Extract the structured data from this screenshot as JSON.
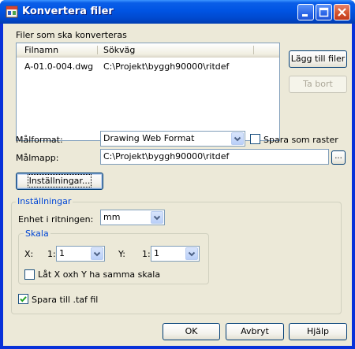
{
  "window": {
    "title": "Konvertera filer"
  },
  "files_section": {
    "label": "Filer som ska konverteras",
    "columns": [
      "Filnamn",
      "Sökväg"
    ],
    "rows": [
      {
        "filename": "A-01.0-004.dwg",
        "path": "C:\\Projekt\\byggh90000\\ritdef"
      }
    ],
    "add_button": "Lägg till filer",
    "remove_button": "Ta bort"
  },
  "target_format": {
    "label": "Målformat:",
    "value": "Drawing Web Format",
    "raster_label": "Spara som raster",
    "raster_checked": false
  },
  "target_folder": {
    "label": "Målmapp:",
    "value": "C:\\Projekt\\byggh90000\\ritdef",
    "browse": "..."
  },
  "settings_button": "Inställningar...",
  "settings_group": {
    "legend": "Inställningar",
    "unit_label": "Enhet i ritningen:",
    "unit_value": "mm",
    "scale": {
      "legend": "Skala",
      "x_label": "X:",
      "x_prefix": "1:",
      "x_value": "1",
      "y_label": "Y:",
      "y_prefix": "1:",
      "y_value": "1",
      "same_scale_label": "Låt X oxh Y ha samma skala",
      "same_scale_checked": false
    },
    "save_taf_label": "Spara till .taf fil",
    "save_taf_checked": true
  },
  "footer": {
    "ok": "OK",
    "cancel": "Avbryt",
    "help": "Hjälp"
  }
}
